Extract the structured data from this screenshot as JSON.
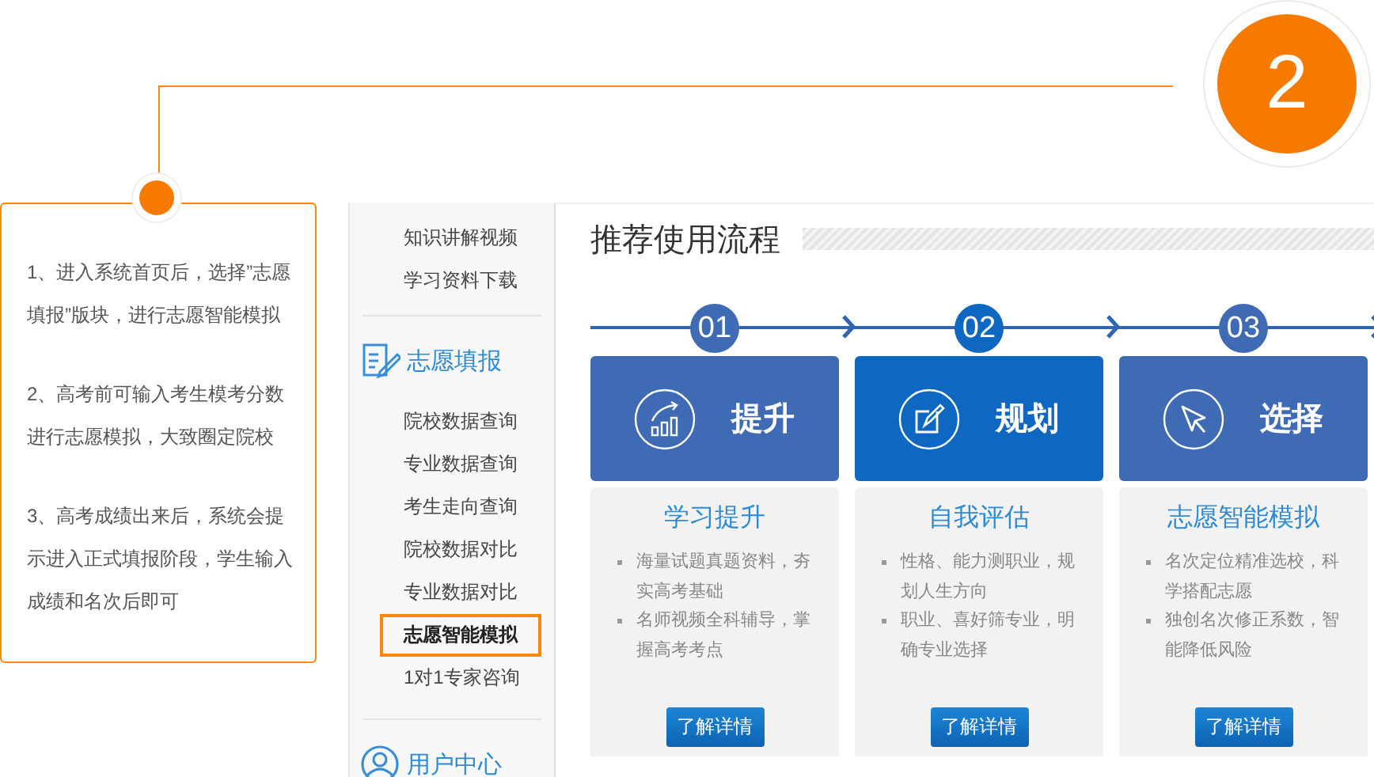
{
  "step_badge": {
    "number": "2"
  },
  "instructions": [
    "1、进入系统首页后，选择”志愿填报”版块，进行志愿智能模拟",
    "2、高考前可输入考生模考分数进行志愿模拟，大致圈定院校",
    "3、高考成绩出来后，系统会提示进入正式填报阶段，学生输入成绩和名次后即可"
  ],
  "sidebar": {
    "top_links": [
      "知识讲解视频",
      "学习资料下载"
    ],
    "sections": [
      {
        "kind": "form",
        "title": "志愿填报",
        "items": [
          {
            "label": "院校数据查询",
            "selected": false
          },
          {
            "label": "专业数据查询",
            "selected": false
          },
          {
            "label": "考生走向查询",
            "selected": false
          },
          {
            "label": "院校数据对比",
            "selected": false
          },
          {
            "label": "专业数据对比",
            "selected": false
          },
          {
            "label": "志愿智能模拟",
            "selected": true
          },
          {
            "label": "1对1专家咨询",
            "selected": false
          }
        ]
      },
      {
        "kind": "user",
        "title": "用户中心"
      }
    ]
  },
  "flow": {
    "title": "推荐使用流程",
    "steps": [
      {
        "number": "01",
        "highlighted": false,
        "kind": "chart",
        "heading": "提升",
        "subtitle": "学习提升",
        "points": [
          "海量试题真题资料，夯实高考基础",
          "名师视频全科辅导，掌握高考考点"
        ],
        "button": "了解详情"
      },
      {
        "number": "02",
        "highlighted": true,
        "kind": "note",
        "heading": "规划",
        "subtitle": "自我评估",
        "points": [
          "性格、能力测职业，规划人生方向",
          "职业、喜好筛专业，明确专业选择"
        ],
        "button": "了解详情"
      },
      {
        "number": "03",
        "highlighted": false,
        "kind": "cursor",
        "heading": "选择",
        "subtitle": "志愿智能模拟",
        "points": [
          "名次定位精准选校，科学搭配志愿",
          "独创名次修正系数，智能降低风险"
        ],
        "button": "了解详情"
      }
    ]
  }
}
